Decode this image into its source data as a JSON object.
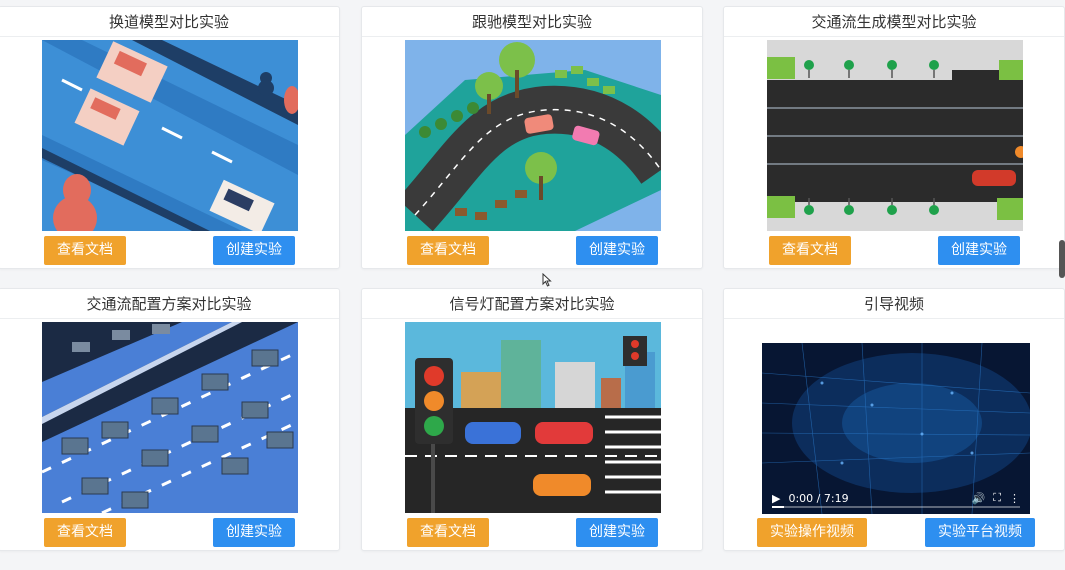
{
  "cards": [
    {
      "title": "换道模型对比实验",
      "left_button": "查看文档",
      "right_button": "创建实验"
    },
    {
      "title": "跟驰模型对比实验",
      "left_button": "查看文档",
      "right_button": "创建实验"
    },
    {
      "title": "交通流生成模型对比实验",
      "left_button": "查看文档",
      "right_button": "创建实验"
    },
    {
      "title": "交通流配置方案对比实验",
      "left_button": "查看文档",
      "right_button": "创建实验"
    },
    {
      "title": "信号灯配置方案对比实验",
      "left_button": "查看文档",
      "right_button": "创建实验"
    },
    {
      "title": "引导视频",
      "left_button": "实验操作视频",
      "right_button": "实验平台视频"
    }
  ],
  "video": {
    "time": "0:00 / 7:19",
    "progress": 0.05
  },
  "colors": {
    "orange": "#f0a22c",
    "blue": "#2e8ff0"
  }
}
